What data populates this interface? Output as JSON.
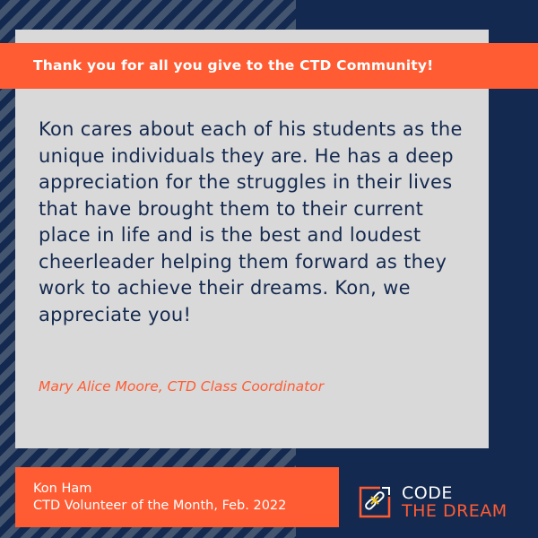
{
  "banner": {
    "text": "Thank you for all you give to the CTD Community!"
  },
  "quote": {
    "text": "Kon cares about each of his students as the unique individuals they are. He has a deep appreciation for the struggles in their lives that have brought them to their current place in life and is the best and loudest cheerleader helping them forward as they work to achieve their dreams. Kon, we appreciate you!",
    "author": "Mary Alice Moore, CTD Class Coordinator"
  },
  "volunteer": {
    "name": "Kon Ham",
    "title": "CTD Volunteer of the Month, Feb. 2022"
  },
  "logo": {
    "line1": "CODE",
    "line2": "THE DREAM"
  },
  "colors": {
    "navy": "#14294f",
    "orange": "#ff5c33",
    "grey": "#d9d9d9"
  }
}
